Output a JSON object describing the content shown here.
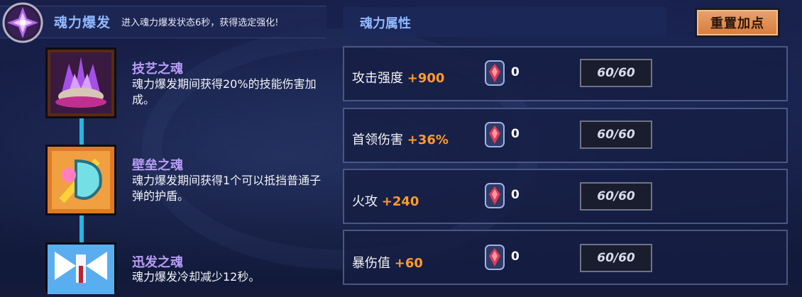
{
  "header": {
    "title": "魂力爆发",
    "description": "进入魂力爆发状态6秒，获得选定强化!"
  },
  "attributes_panel": {
    "title": "魂力属性",
    "reset_button": "重置加点"
  },
  "skills": [
    {
      "name": "技艺之魂",
      "description": "魂力爆发期间获得20%的技能伤害加成。",
      "icon": "purple-crystal-shell-icon"
    },
    {
      "name": "壁垒之魂",
      "description": "魂力爆发期间获得1个可以抵挡普通子弹的护盾。",
      "icon": "orange-shield-icon"
    },
    {
      "name": "迅发之魂",
      "description": "魂力爆发冷却减少12秒。",
      "icon": "blue-winged-icon"
    }
  ],
  "attributes": [
    {
      "name": "攻击强度",
      "bonus": "+900",
      "gems": "0",
      "level": "60/60"
    },
    {
      "name": "首领伤害",
      "bonus": "+36%",
      "gems": "0",
      "level": "60/60"
    },
    {
      "name": "火攻",
      "bonus": "+240",
      "gems": "0",
      "level": "60/60"
    },
    {
      "name": "暴伤值",
      "bonus": "+60",
      "gems": "0",
      "level": "60/60"
    }
  ],
  "colors": {
    "accent_blue": "#8fb8ff",
    "bonus_orange": "#ff9a2e",
    "skill_name_purple": "#b79cf5",
    "button_orange": "#d77b3e"
  }
}
